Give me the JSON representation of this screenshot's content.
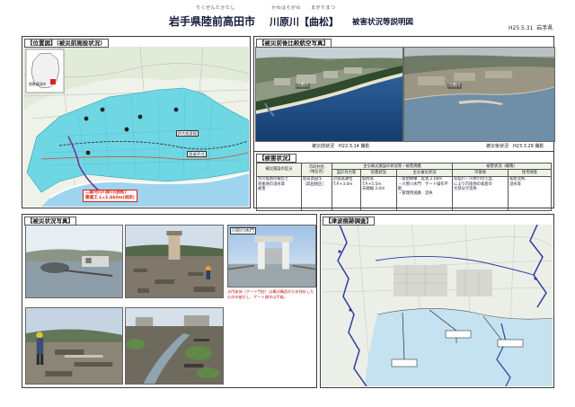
{
  "header": {
    "ruby": [
      "りくぜんたかたし",
      "かわはらがわ",
      "まがりまつ"
    ],
    "title_pref": "岩手県陸前高田市",
    "title_river": "川原川【曲松】",
    "title_rest": "被害状況等説明図",
    "date": "H25.5.31",
    "org": "岩手県"
  },
  "location": {
    "title": "【位置図】（被災前施設状況）",
    "inset_label": "陸前高田市",
    "annotation_line1": "二級河川川原川(曲松)",
    "annotation_line2": "築堤工 L=1,660m(両岸)",
    "label_rail": "JR大船渡線",
    "label_road": "国道45号",
    "colors": {
      "flood": "#6fd6e3",
      "sea": "#9fd4ef",
      "annotation": "#d21f1f",
      "river": "#7a2fa0"
    }
  },
  "aerial": {
    "title": "【被災前後比較航空写真】",
    "before_caption": "被災前状況　H22.3.14 撮影",
    "after_caption": "被災後状況　H23.3.29 撮影",
    "before_label": "川原川",
    "after_label": "川原川"
  },
  "damage": {
    "title": "【被害状況】",
    "headers": {
      "category": "被災施設の区分",
      "municipality": "市町村名\n（地区名）",
      "facility_group": "主な被災施設の状況等・被害規模",
      "design": "設計外力等",
      "form": "形態状況",
      "main": "主な被災状況",
      "summary_group": "被害状況（概略）",
      "urban": "市街地",
      "residential": "住宅地等"
    },
    "row": {
      "category": "河川堤防の被災と\n背後地の浸水等\n被害",
      "municipality": "陸前高田市\n（高田地区）",
      "design": "計画高潮位\nT.P.+3.0m",
      "form": "堤防高\nT.P.+5.5m\n天端幅 3.0m",
      "main": "・堤防倒壊　延長 2.0km\n・川原川水門　ゲート操作不能\n・管理用道路　流失",
      "urban": "気仙川・川原川の氾濫\nにより市街地の家屋の\n大部分が流失",
      "residential": "家屋流失、\n浸水等"
    }
  },
  "photos": {
    "title": "【被災状況写真】",
    "gate_label": "川原川水門",
    "gate_caption_1": "水門本体（ゲート門柱）は橋式構造のため残存した",
    "gate_caption_2": "ものの被災し、ゲート操作は不能。"
  },
  "tsunami": {
    "title": "【津波痕跡調査】",
    "colors": {
      "sea": "#c4e2f0",
      "trace_line": "#2f3f9f"
    }
  }
}
